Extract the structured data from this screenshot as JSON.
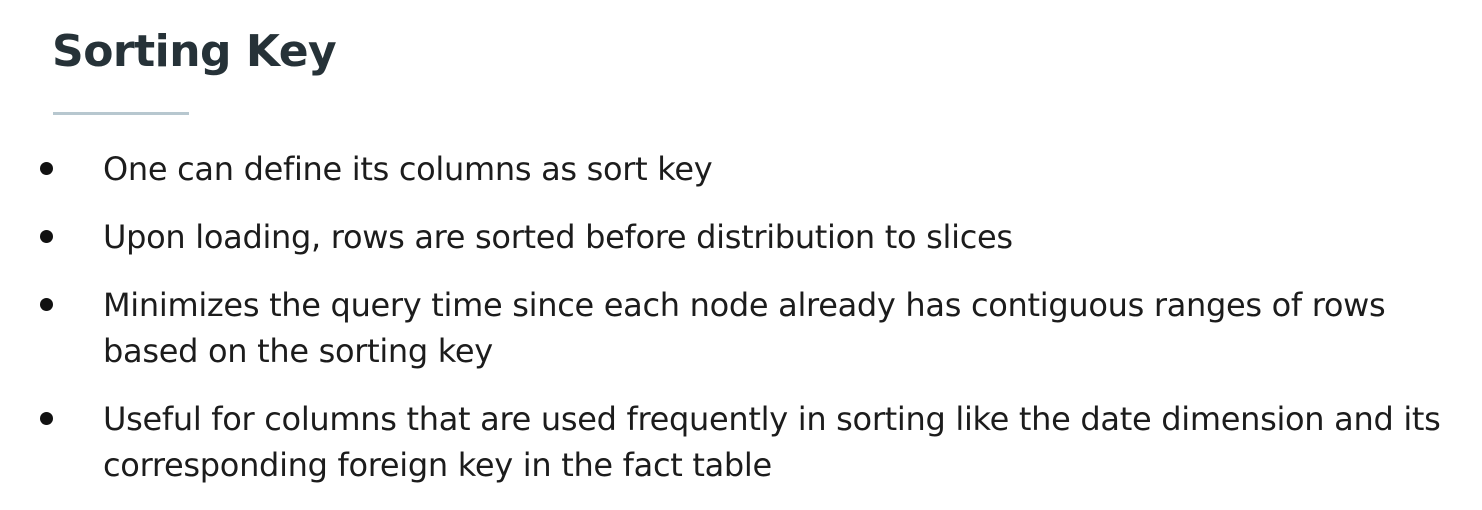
{
  "slide": {
    "title": "Sorting Key",
    "bullets": [
      "One can define its columns as sort key",
      "Upon loading, rows are sorted before distribution to slices",
      "Minimizes the query time since each node already has contiguous ranges of rows based on the sorting key",
      "Useful for columns that are used frequently in sorting like the date dimension and its corresponding foreign key in the fact table"
    ]
  },
  "colors": {
    "title": "#263238",
    "underline": "#b7c7cf",
    "text": "#1c1c1c",
    "background": "#ffffff"
  }
}
